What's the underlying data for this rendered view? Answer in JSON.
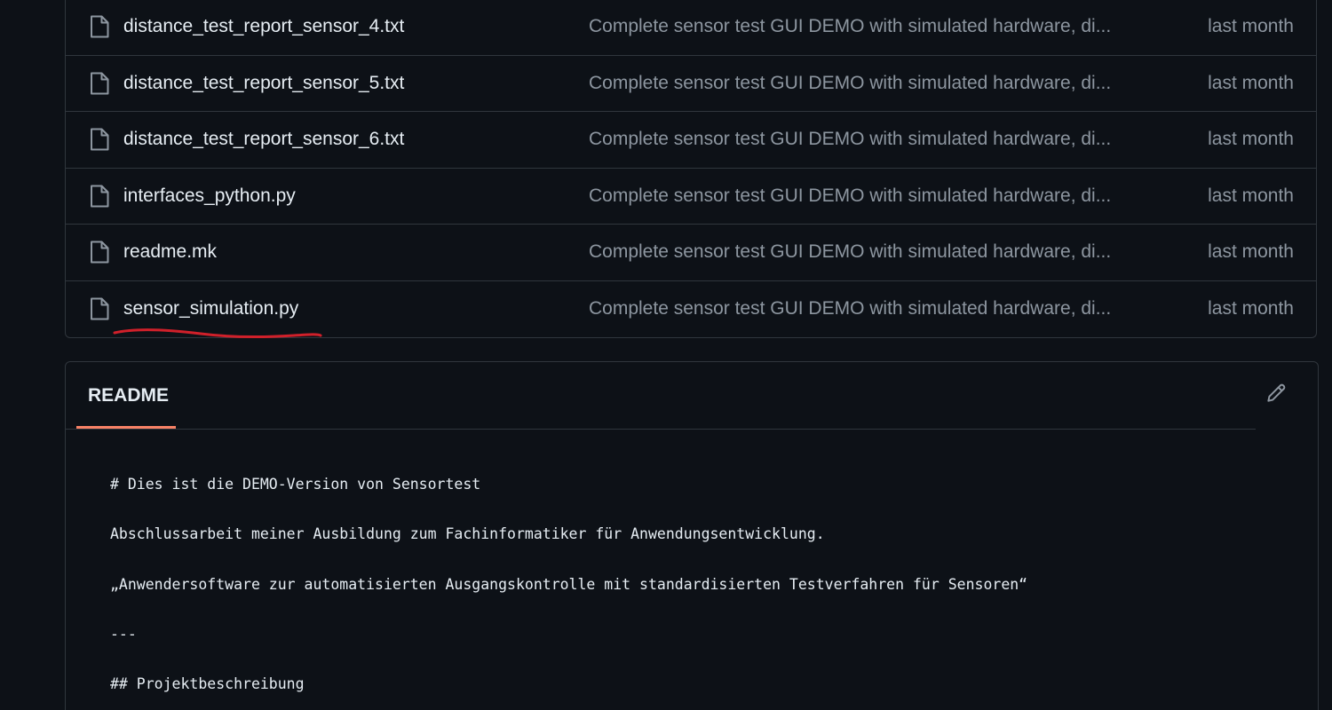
{
  "files": [
    {
      "name": "distance_test_report_sensor_4.txt",
      "commit": "Complete sensor test GUI DEMO with simulated hardware, di...",
      "date": "last month"
    },
    {
      "name": "distance_test_report_sensor_5.txt",
      "commit": "Complete sensor test GUI DEMO with simulated hardware, di...",
      "date": "last month"
    },
    {
      "name": "distance_test_report_sensor_6.txt",
      "commit": "Complete sensor test GUI DEMO with simulated hardware, di...",
      "date": "last month"
    },
    {
      "name": "interfaces_python.py",
      "commit": "Complete sensor test GUI DEMO with simulated hardware, di...",
      "date": "last month"
    },
    {
      "name": "readme.mk",
      "commit": "Complete sensor test GUI DEMO with simulated hardware, di...",
      "date": "last month"
    },
    {
      "name": "sensor_simulation.py",
      "commit": "Complete sensor test GUI DEMO with simulated hardware, di...",
      "date": "last month"
    }
  ],
  "annotation": {
    "color": "#d0202a",
    "target": "sensor_simulation.py"
  },
  "readme": {
    "tab_label": "README",
    "edit_icon": "pencil-icon",
    "tab_underline_color": "#f78166",
    "lines": [
      "# Dies ist die DEMO-Version von Sensortest",
      "Abschlussarbeit meiner Ausbildung zum Fachinformatiker für Anwendungsentwicklung.",
      "„Anwendersoftware zur automatisierten Ausgangskontrolle mit standardisierten Testverfahren für Sensoren“",
      "---",
      "## Projektbeschreibung"
    ]
  },
  "theme": {
    "background": "#0d1117",
    "border": "#30363d",
    "text": "#e6edf3",
    "muted": "#8d96a0"
  }
}
